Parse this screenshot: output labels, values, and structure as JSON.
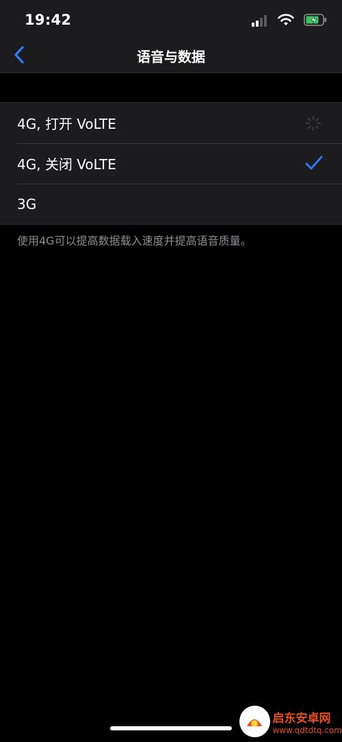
{
  "status_bar": {
    "time": "19:42",
    "icons": [
      "cellular-signal-icon",
      "wifi-icon",
      "battery-charging-icon"
    ]
  },
  "nav": {
    "back_icon": "chevron-left-icon",
    "title": "语音与数据"
  },
  "options": [
    {
      "label": "4G, 打开 VoLTE",
      "state": "loading"
    },
    {
      "label": "4G, 关闭 VoLTE",
      "state": "selected"
    },
    {
      "label": "3G",
      "state": "none"
    }
  ],
  "footnote": "使用4G可以提高数据载入速度并提高语音质量。",
  "watermark": {
    "title": "启东安卓网",
    "url": "www.qdtdtq.com"
  },
  "colors": {
    "accent": "#3478f6",
    "background": "#000000",
    "cell_background": "#1c1c1e",
    "secondary_text": "#8d8d93",
    "watermark": "#e84f1f"
  }
}
